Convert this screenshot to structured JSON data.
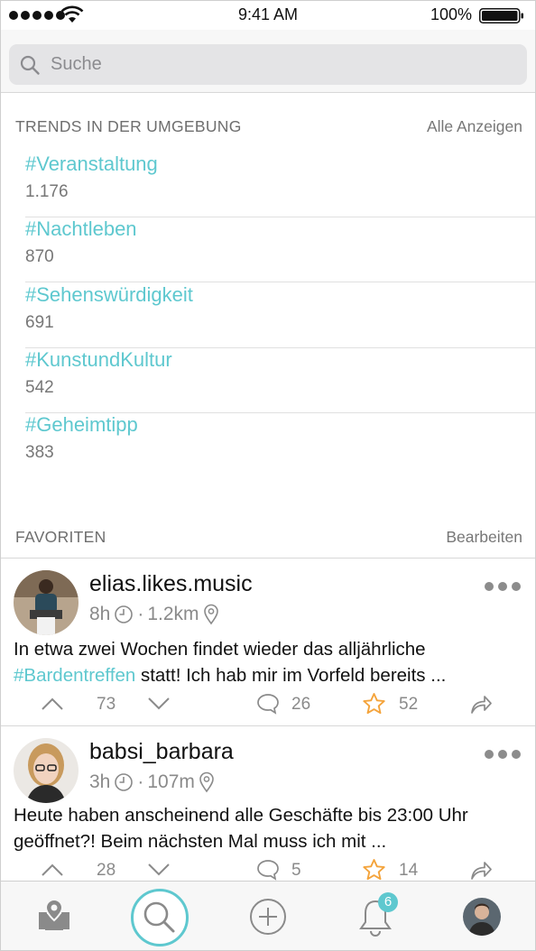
{
  "status_bar": {
    "time": "9:41 AM",
    "battery": "100%"
  },
  "search": {
    "placeholder": "Suche",
    "icon": "search-icon"
  },
  "trends": {
    "title": "TRENDS IN DER UMGEBUNG",
    "action": "Alle Anzeigen",
    "items": [
      {
        "tag": "#Veranstaltung",
        "count": "1.176"
      },
      {
        "tag": "#Nachtleben",
        "count": "870"
      },
      {
        "tag": "#Sehenswürdigkeit",
        "count": "691"
      },
      {
        "tag": "#KunstundKultur",
        "count": "542"
      },
      {
        "tag": "#Geheimtipp",
        "count": "383"
      }
    ]
  },
  "favorites": {
    "title": "FAVORITEN",
    "action": "Bearbeiten",
    "posts": [
      {
        "user": "elias.likes.music",
        "age": "8h",
        "distance": "1.2km",
        "text_before": "In etwa zwei Wochen findet wieder das alljährliche ",
        "hashtag": "#Bardentreffen",
        "text_after": " statt! Ich hab mir im Vorfeld bereits ...",
        "votes": "73",
        "comments": "26",
        "stars": "52"
      },
      {
        "user": "babsi_barbara",
        "age": "3h",
        "distance": "107m",
        "text_before": "Heute haben anscheinend alle Geschäfte bis 23:00 Uhr geöffnet?! Beim nächsten Mal muss ich mit ...",
        "hashtag": "",
        "text_after": "",
        "votes": "28",
        "comments": "5",
        "stars": "14"
      }
    ]
  },
  "tabbar": {
    "tabs": [
      "map-pin-icon",
      "search-icon",
      "add-icon",
      "bell-icon",
      "profile-avatar"
    ],
    "notifications": "6",
    "accent": "#5ec8cf"
  },
  "colors": {
    "accent": "#5ec8cf",
    "star": "#f4a43c",
    "text_secondary": "#8a8a8a"
  }
}
